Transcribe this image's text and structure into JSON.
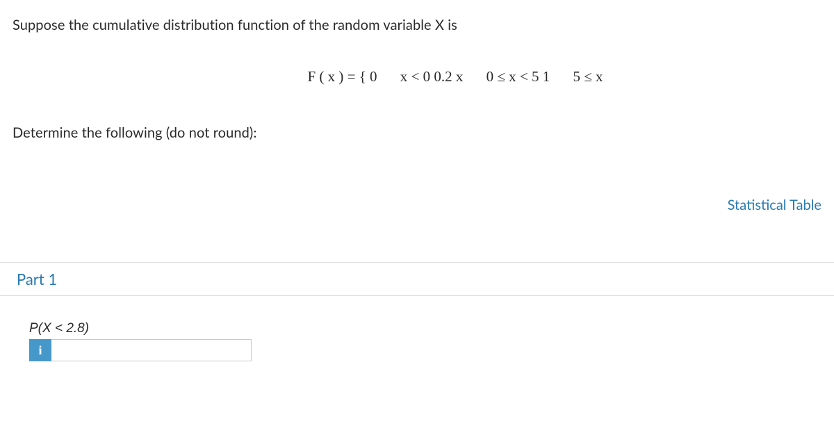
{
  "intro": "Suppose the cumulative distribution function of the random variable X is",
  "formula": {
    "lhs": "F ( x ) = { 0",
    "piece1": "x < 0 0.2 x",
    "piece2": "0 ≤ x < 5 1",
    "piece3": "5 ≤ x"
  },
  "determine": "Determine the following (do not round):",
  "link": "Statistical Table",
  "part": {
    "title": "Part 1",
    "question": "P(X < 2.8)",
    "info_glyph": "i",
    "answer_value": ""
  }
}
